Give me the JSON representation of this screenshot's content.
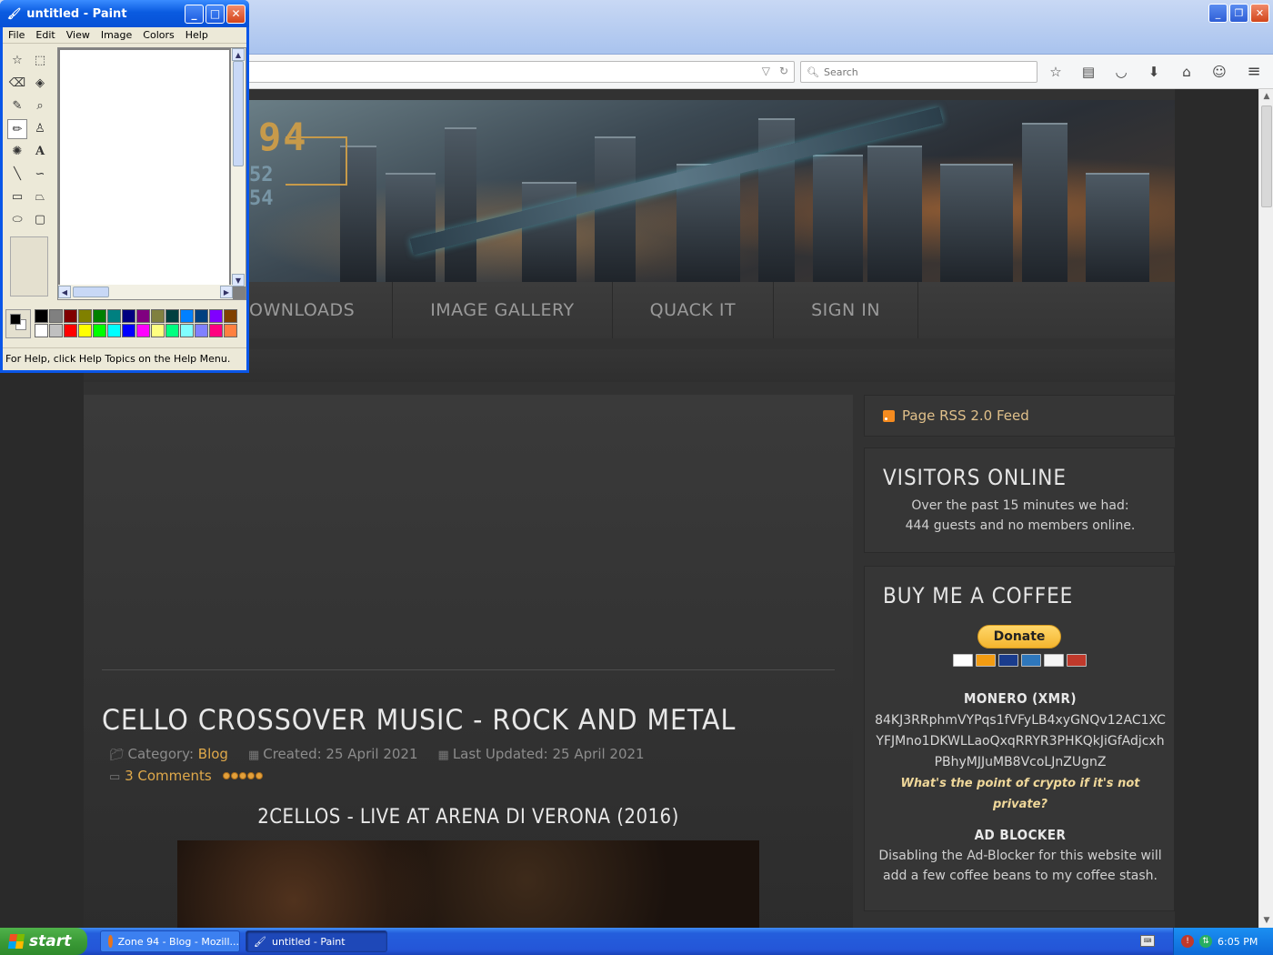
{
  "firefox": {
    "search_placeholder": "Search",
    "win_buttons": [
      "_",
      "❐",
      "✕"
    ]
  },
  "banner": {
    "logo_main": "94",
    "logo_sub1": "52",
    "logo_sub2": "54"
  },
  "nav": {
    "items": [
      "OWNLOADS",
      "IMAGE GALLERY",
      "QUACK IT",
      "SIGN IN"
    ]
  },
  "article": {
    "title": "CELLO CROSSOVER MUSIC - ROCK AND METAL",
    "category_label": "Category:",
    "category_value": "Blog",
    "created": "Created: 25 April 2021",
    "updated": "Last Updated: 25 April 2021",
    "comments": "3 Comments",
    "rating_stars": 5,
    "video_title": "2CELLOS - LIVE AT ARENA DI VERONA (2016)"
  },
  "sidebar": {
    "rss": "Page RSS 2.0 Feed",
    "visitors": {
      "heading": "VISITORS ONLINE",
      "line1": "Over the past 15 minutes we had:",
      "line2": "444 guests and no members online."
    },
    "coffee": {
      "heading": "BUY ME A COFFEE",
      "donate": "Donate",
      "monero_heading": "MONERO (XMR)",
      "address_lines": [
        "84KJ3RRphmVYPqs1fVFyLB4xyGNQv12AC1XC",
        "YFJMno1DKWLLaoQxqRRYR3PHKQkJiGfAdjcxh",
        "PBhyMJJuMB8VcoLJnZUgnZ"
      ],
      "quote_lines": [
        "What's the point of crypto if it's not",
        "private?"
      ],
      "adblock_heading": "AD BLOCKER",
      "adblock_lines": [
        "Disabling the Ad-Blocker for this website will",
        "add a few coffee beans to my coffee stash."
      ]
    }
  },
  "paint": {
    "title": "untitled - Paint",
    "menu": [
      "File",
      "Edit",
      "View",
      "Image",
      "Colors",
      "Help"
    ],
    "status": "For Help, click Help Topics on the Help Menu.",
    "palette_top": [
      "#000000",
      "#808080",
      "#800000",
      "#808000",
      "#008000",
      "#008080",
      "#000080",
      "#800080",
      "#808040",
      "#004040",
      "#0080ff",
      "#004080",
      "#8000ff",
      "#804000"
    ],
    "palette_bottom": [
      "#ffffff",
      "#c0c0c0",
      "#ff0000",
      "#ffff00",
      "#00ff00",
      "#00ffff",
      "#0000ff",
      "#ff00ff",
      "#ffff80",
      "#00ff80",
      "#80ffff",
      "#8080ff",
      "#ff0080",
      "#ff8040"
    ]
  },
  "taskbar": {
    "start": "start",
    "task1": "Zone 94 - Blog - Mozill...",
    "task2": "untitled - Paint",
    "clock": "6:05 PM"
  }
}
